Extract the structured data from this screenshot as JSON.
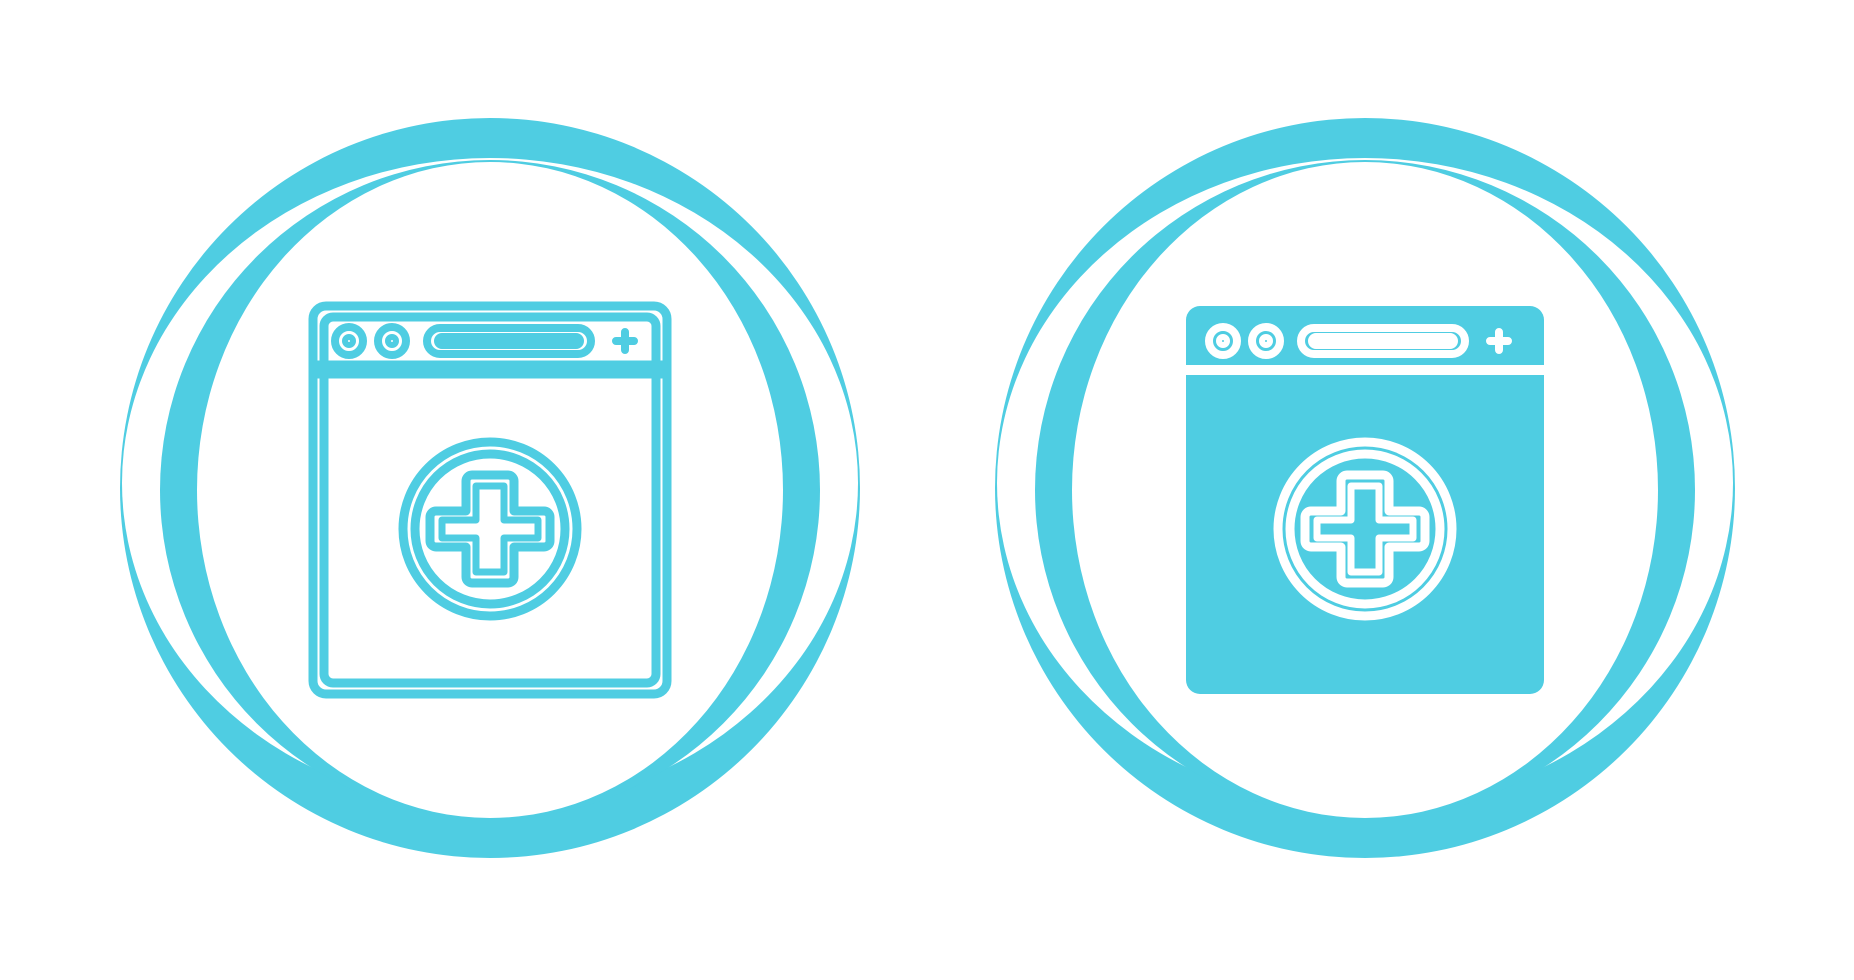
{
  "theme": {
    "accent": "#4FCDE2",
    "background": "#FFFFFF"
  },
  "icons": [
    {
      "name": "medical-browser-icon",
      "style": "outline"
    },
    {
      "name": "medical-browser-icon",
      "style": "filled"
    }
  ]
}
